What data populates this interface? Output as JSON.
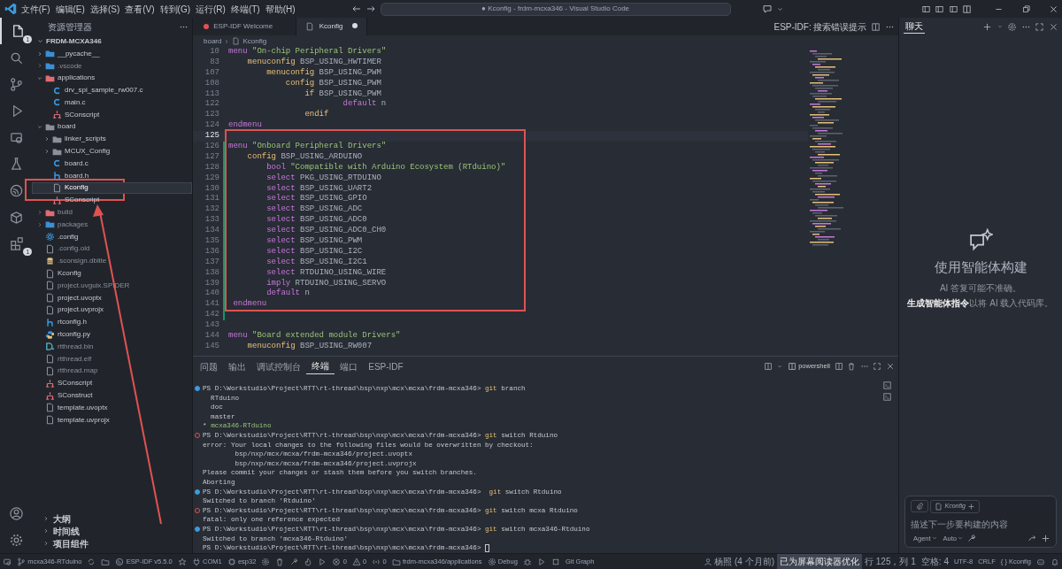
{
  "title_bar": {
    "menus": [
      "文件(F)",
      "编辑(E)",
      "选择(S)",
      "查看(V)",
      "转到(G)",
      "运行(R)",
      "终端(T)",
      "帮助(H)"
    ],
    "command_center": "● Kconfig - frdm-mcxa346 - Visual Studio Code"
  },
  "activity_bar": {
    "items": [
      {
        "kind": "files",
        "selected": true,
        "badge": "1"
      },
      {
        "kind": "search",
        "selected": false
      },
      {
        "kind": "branch",
        "selected": false
      },
      {
        "kind": "debug",
        "selected": false
      },
      {
        "kind": "remote",
        "selected": false
      },
      {
        "kind": "flask",
        "selected": false
      },
      {
        "kind": "esp",
        "selected": false
      },
      {
        "kind": "box",
        "selected": false
      },
      {
        "kind": "extensions",
        "selected": false,
        "badge": "1"
      }
    ],
    "bottom": [
      {
        "kind": "account"
      },
      {
        "kind": "gear"
      }
    ]
  },
  "explorer": {
    "title": "资源管理器",
    "root": "FRDM-MCXA346",
    "tree": [
      {
        "name": "__pycache__",
        "kind": "folder-python",
        "expanded": false,
        "dimmed": false,
        "selected": false
      },
      {
        "name": ".vscode",
        "kind": "folder-vscode",
        "expanded": false,
        "dimmed": true,
        "selected": false
      },
      {
        "name": "applications",
        "kind": "folder-app",
        "expanded": true,
        "dimmed": false,
        "selected": false,
        "children": [
          {
            "name": "drv_spi_sample_rw007.c",
            "kind": "c",
            "dimmed": false,
            "selected": false
          },
          {
            "name": "main.c",
            "kind": "c",
            "dimmed": false,
            "selected": false
          },
          {
            "name": "SConscript",
            "kind": "scons",
            "dimmed": false,
            "selected": false
          }
        ]
      },
      {
        "name": "board",
        "kind": "folder",
        "expanded": true,
        "dimmed": false,
        "selected": false,
        "children": [
          {
            "name": "linker_scripts",
            "kind": "folder",
            "expanded": false,
            "dimmed": false,
            "selected": false
          },
          {
            "name": "MCUX_Config",
            "kind": "folder",
            "expanded": false,
            "dimmed": false,
            "selected": false
          },
          {
            "name": "board.c",
            "kind": "c",
            "dimmed": false,
            "selected": false
          },
          {
            "name": "board.h",
            "kind": "h",
            "dimmed": false,
            "selected": false
          },
          {
            "name": "Kconfig",
            "kind": "file",
            "dimmed": false,
            "selected": true
          },
          {
            "name": "SConscript",
            "kind": "scons",
            "dimmed": false,
            "selected": false
          }
        ]
      },
      {
        "name": "build",
        "kind": "folder-build",
        "expanded": false,
        "dimmed": true,
        "selected": false
      },
      {
        "name": "packages",
        "kind": "folder-packages",
        "expanded": false,
        "dimmed": true,
        "selected": false
      },
      {
        "name": ".config",
        "kind": "gear",
        "dimmed": false,
        "selected": false
      },
      {
        "name": ".config.old",
        "kind": "file",
        "dimmed": true,
        "selected": false
      },
      {
        "name": ".sconsign.dblite",
        "kind": "db",
        "dimmed": true,
        "selected": false
      },
      {
        "name": "Kconfig",
        "kind": "file",
        "dimmed": false,
        "selected": false
      },
      {
        "name": "project.uvguix.SPIDER",
        "kind": "file",
        "dimmed": true,
        "selected": false
      },
      {
        "name": "project.uvoptx",
        "kind": "file",
        "dimmed": false,
        "selected": false
      },
      {
        "name": "project.uvprojx",
        "kind": "file",
        "dimmed": false,
        "selected": false
      },
      {
        "name": "rtconfig.h",
        "kind": "h",
        "dimmed": false,
        "selected": false
      },
      {
        "name": "rtconfig.py",
        "kind": "py",
        "dimmed": false,
        "selected": false
      },
      {
        "name": "rtthread.bin",
        "kind": "bin",
        "dimmed": true,
        "selected": false
      },
      {
        "name": "rtthread.elf",
        "kind": "file",
        "dimmed": true,
        "selected": false
      },
      {
        "name": "rtthread.map",
        "kind": "file",
        "dimmed": true,
        "selected": false
      },
      {
        "name": "SConscript",
        "kind": "scons",
        "dimmed": false,
        "selected": false
      },
      {
        "name": "SConstruct",
        "kind": "scons",
        "dimmed": false,
        "selected": false
      },
      {
        "name": "template.uvoptx",
        "kind": "file",
        "dimmed": false,
        "selected": false
      },
      {
        "name": "template.uvprojx",
        "kind": "file",
        "dimmed": false,
        "selected": false
      }
    ],
    "sections": [
      "大纲",
      "时间线",
      "项目组件"
    ]
  },
  "editor": {
    "tabs": [
      {
        "label": "ESP-IDF Welcome",
        "kind": "esp",
        "selected": false,
        "modified": false
      },
      {
        "label": "Kconfig",
        "kind": "file",
        "selected": true,
        "modified": true
      }
    ],
    "actions_label": "ESP-IDF: 搜索错误提示",
    "breadcrumb": [
      "board",
      "Kconfig"
    ],
    "lines": [
      {
        "n": "10",
        "current": false,
        "changed": false,
        "tokens": [
          {
            "text": "menu",
            "kind": "keyword"
          },
          {
            "text": " \"On-chip Peripheral Drivers\"",
            "kind": "string"
          }
        ]
      },
      {
        "n": "83",
        "current": false,
        "changed": false,
        "tokens": [
          {
            "text": "    menuconfig",
            "kind": "config-keyword"
          },
          {
            "text": " BSP_USING_HWTIMER",
            "kind": "identifier"
          }
        ]
      },
      {
        "n": "107",
        "current": false,
        "changed": false,
        "tokens": [
          {
            "text": "        menuconfig",
            "kind": "config-keyword"
          },
          {
            "text": " BSP_USING_PWM",
            "kind": "identifier"
          }
        ]
      },
      {
        "n": "108",
        "current": false,
        "changed": false,
        "tokens": [
          {
            "text": "            config",
            "kind": "config-keyword"
          },
          {
            "text": " BSP_USING_PWM",
            "kind": "identifier"
          }
        ]
      },
      {
        "n": "113",
        "current": false,
        "changed": false,
        "tokens": [
          {
            "text": "                if",
            "kind": "config-keyword"
          },
          {
            "text": " BSP_USING_PWM",
            "kind": "identifier"
          }
        ]
      },
      {
        "n": "122",
        "current": false,
        "changed": false,
        "tokens": [
          {
            "text": "                        default",
            "kind": "keyword"
          },
          {
            "text": " n",
            "kind": "identifier"
          }
        ]
      },
      {
        "n": "123",
        "current": false,
        "changed": false,
        "tokens": [
          {
            "text": "                endif",
            "kind": "config-keyword"
          }
        ]
      },
      {
        "n": "124",
        "current": false,
        "changed": false,
        "tokens": [
          {
            "text": "endmenu",
            "kind": "keyword"
          }
        ]
      },
      {
        "n": "125",
        "current": true,
        "changed": false
      },
      {
        "n": "126",
        "current": false,
        "changed": true,
        "tokens": [
          {
            "text": "menu",
            "kind": "keyword"
          },
          {
            "text": " \"Onboard Peripheral Drivers\"",
            "kind": "string"
          }
        ]
      },
      {
        "n": "127",
        "current": false,
        "changed": true,
        "tokens": [
          {
            "text": "    config",
            "kind": "config-keyword"
          },
          {
            "text": " BSP_USING_ARDUINO",
            "kind": "identifier"
          }
        ]
      },
      {
        "n": "128",
        "current": false,
        "changed": true,
        "tokens": [
          {
            "text": "        bool",
            "kind": "keyword"
          },
          {
            "text": " \"Compatible with Arduino Ecosystem (RTduino)\"",
            "kind": "string"
          }
        ]
      },
      {
        "n": "129",
        "current": false,
        "changed": true,
        "tokens": [
          {
            "text": "        select",
            "kind": "keyword"
          },
          {
            "text": " PKG_USING_RTDUINO",
            "kind": "identifier"
          }
        ]
      },
      {
        "n": "130",
        "current": false,
        "changed": true,
        "tokens": [
          {
            "text": "        select",
            "kind": "keyword"
          },
          {
            "text": " BSP_USING_UART2",
            "kind": "identifier"
          }
        ]
      },
      {
        "n": "131",
        "current": false,
        "changed": true,
        "tokens": [
          {
            "text": "        select",
            "kind": "keyword"
          },
          {
            "text": " BSP_USING_GPIO",
            "kind": "identifier"
          }
        ]
      },
      {
        "n": "132",
        "current": false,
        "changed": true,
        "tokens": [
          {
            "text": "        select",
            "kind": "keyword"
          },
          {
            "text": " BSP_USING_ADC",
            "kind": "identifier"
          }
        ]
      },
      {
        "n": "133",
        "current": false,
        "changed": true,
        "tokens": [
          {
            "text": "        select",
            "kind": "keyword"
          },
          {
            "text": " BSP_USING_ADC0",
            "kind": "identifier"
          }
        ]
      },
      {
        "n": "134",
        "current": false,
        "changed": true,
        "tokens": [
          {
            "text": "        select",
            "kind": "keyword"
          },
          {
            "text": " BSP_USING_ADC0_CH0",
            "kind": "identifier"
          }
        ]
      },
      {
        "n": "135",
        "current": false,
        "changed": true,
        "tokens": [
          {
            "text": "        select",
            "kind": "keyword"
          },
          {
            "text": " BSP_USING_PWM",
            "kind": "identifier"
          }
        ]
      },
      {
        "n": "136",
        "current": false,
        "changed": true,
        "tokens": [
          {
            "text": "        select",
            "kind": "keyword"
          },
          {
            "text": " BSP_USING_I2C",
            "kind": "identifier"
          }
        ]
      },
      {
        "n": "137",
        "current": false,
        "changed": true,
        "tokens": [
          {
            "text": "        select",
            "kind": "keyword"
          },
          {
            "text": " BSP_USING_I2C1",
            "kind": "identifier"
          }
        ]
      },
      {
        "n": "138",
        "current": false,
        "changed": true,
        "tokens": [
          {
            "text": "        select",
            "kind": "keyword"
          },
          {
            "text": " RTDUINO_USING_WIRE",
            "kind": "identifier"
          }
        ]
      },
      {
        "n": "139",
        "current": false,
        "changed": true,
        "tokens": [
          {
            "text": "        imply",
            "kind": "keyword"
          },
          {
            "text": " RTDUINO_USING_SERVO",
            "kind": "identifier"
          }
        ]
      },
      {
        "n": "140",
        "current": false,
        "changed": true,
        "tokens": [
          {
            "text": "        default",
            "kind": "keyword"
          },
          {
            "text": " n",
            "kind": "identifier"
          }
        ]
      },
      {
        "n": "141",
        "current": false,
        "changed": true,
        "tokens": [
          {
            "text": " endmenu",
            "kind": "keyword"
          }
        ]
      },
      {
        "n": "142",
        "current": false,
        "changed": true
      },
      {
        "n": "143",
        "current": false,
        "changed": false
      },
      {
        "n": "144",
        "current": false,
        "changed": false,
        "tokens": [
          {
            "text": "menu",
            "kind": "keyword"
          },
          {
            "text": " \"Board extended module Drivers\"",
            "kind": "string"
          }
        ]
      },
      {
        "n": "145",
        "current": false,
        "changed": false,
        "tokens": [
          {
            "text": "    menuconfig",
            "kind": "config-keyword"
          },
          {
            "text": " BSP_USING_RW007",
            "kind": "identifier"
          }
        ]
      }
    ]
  },
  "panel": {
    "tabs": [
      {
        "label": "问题",
        "selected": false
      },
      {
        "label": "输出",
        "selected": false
      },
      {
        "label": "调试控制台",
        "selected": false
      },
      {
        "label": "终端",
        "selected": true
      },
      {
        "label": "端口",
        "selected": false
      },
      {
        "label": "ESP-IDF",
        "selected": false
      }
    ],
    "shell": "powershell",
    "terminal": [
      {
        "kind": "prompt-ok",
        "path": "PS D:\\Workstudio\\Project\\RTT\\rt-thread\\bsp\\nxp\\mcx\\mcxa\\frdm-mcxa346> ",
        "program": "git",
        "args": " branch"
      },
      {
        "kind": "output",
        "text": "  RTduino"
      },
      {
        "kind": "output",
        "text": "  doc"
      },
      {
        "kind": "output",
        "text": "  master"
      },
      {
        "kind": "current-branch",
        "marker": "* ",
        "text": "mcxa346-RTduino"
      },
      {
        "kind": "prompt-error",
        "path": "PS D:\\Workstudio\\Project\\RTT\\rt-thread\\bsp\\nxp\\mcx\\mcxa\\frdm-mcxa346> ",
        "program": "git",
        "args": " switch Rtduino"
      },
      {
        "kind": "output",
        "text": "error: Your local changes to the following files would be overwritten by checkout:"
      },
      {
        "kind": "output",
        "text": "        bsp/nxp/mcx/mcxa/frdm-mcxa346/project.uvoptx"
      },
      {
        "kind": "output",
        "text": "        bsp/nxp/mcx/mcxa/frdm-mcxa346/project.uvprojx"
      },
      {
        "kind": "output",
        "text": "Please commit your changes or stash them before you switch branches."
      },
      {
        "kind": "output",
        "text": "Aborting"
      },
      {
        "kind": "prompt-ok",
        "path": "PS D:\\Workstudio\\Project\\RTT\\rt-thread\\bsp\\nxp\\mcx\\mcxa\\frdm-mcxa346> ",
        "program": " git",
        "args": " switch Rtduino"
      },
      {
        "kind": "output",
        "text": "Switched to branch 'Rtduino'"
      },
      {
        "kind": "prompt-error",
        "path": "PS D:\\Workstudio\\Project\\RTT\\rt-thread\\bsp\\nxp\\mcx\\mcxa\\frdm-mcxa346> ",
        "program": "git",
        "args": " switch mcxa Rtduino"
      },
      {
        "kind": "output",
        "text": "fatal: only one reference expected"
      },
      {
        "kind": "prompt-ok",
        "path": "PS D:\\Workstudio\\Project\\RTT\\rt-thread\\bsp\\nxp\\mcx\\mcxa\\frdm-mcxa346> ",
        "program": "git",
        "args": " switch mcxa346-Rtduino"
      },
      {
        "kind": "output",
        "text": "Switched to branch 'mcxa346-Rtduino'"
      },
      {
        "kind": "prompt-input",
        "path": "PS D:\\Workstudio\\Project\\RTT\\rt-thread\\bsp\\nxp\\mcx\\mcxa\\frdm-mcxa346> "
      }
    ]
  },
  "chat": {
    "tab": "聊天",
    "heading": "使用智能体构建",
    "note": "AI 答复可能不准确。",
    "hint": "**生成智能体指令**以将 AI 载入代码库。",
    "context_file": "Kconfig",
    "placeholder": "描述下一步要构建的内容",
    "mode": "Agent",
    "model": "Auto"
  },
  "status_bar": {
    "left": [
      {
        "kind": "remote"
      },
      {
        "kind": "branch",
        "text": "mcxa346-RTduino"
      },
      {
        "kind": "sync"
      },
      {
        "kind": "folder"
      },
      {
        "kind": "esp",
        "text": "ESP-IDF v5.5.0"
      },
      {
        "kind": "star"
      },
      {
        "kind": "plug",
        "text": "COM1"
      },
      {
        "kind": "chip",
        "text": "esp32"
      },
      {
        "kind": "gear"
      },
      {
        "kind": "trash"
      },
      {
        "kind": "tool"
      },
      {
        "kind": "flame"
      },
      {
        "kind": "play"
      },
      {
        "kind": "error",
        "text": "0"
      },
      {
        "kind": "warning",
        "text": "0"
      },
      {
        "kind": "antenna",
        "text": "0"
      },
      {
        "kind": "folder",
        "text": "frdm-mcxa346/applications"
      },
      {
        "kind": "gear",
        "text": "Debug"
      },
      {
        "kind": "bug"
      },
      {
        "kind": "play"
      },
      {
        "kind": "square"
      },
      {
        "text": "Git Graph"
      }
    ],
    "right": [
      {
        "kind": "person",
        "text": "杨照 (4 个月前)"
      },
      {
        "text": "已为屏幕阅读器优化",
        "highlight": true
      },
      {
        "text": "行 125，列 1"
      },
      {
        "text": "空格: 4"
      },
      {
        "text": "UTF-8"
      },
      {
        "text": "CRLF"
      },
      {
        "text": "{ } Kconfig"
      },
      {
        "kind": "copilot"
      },
      {
        "kind": "bell"
      }
    ]
  }
}
